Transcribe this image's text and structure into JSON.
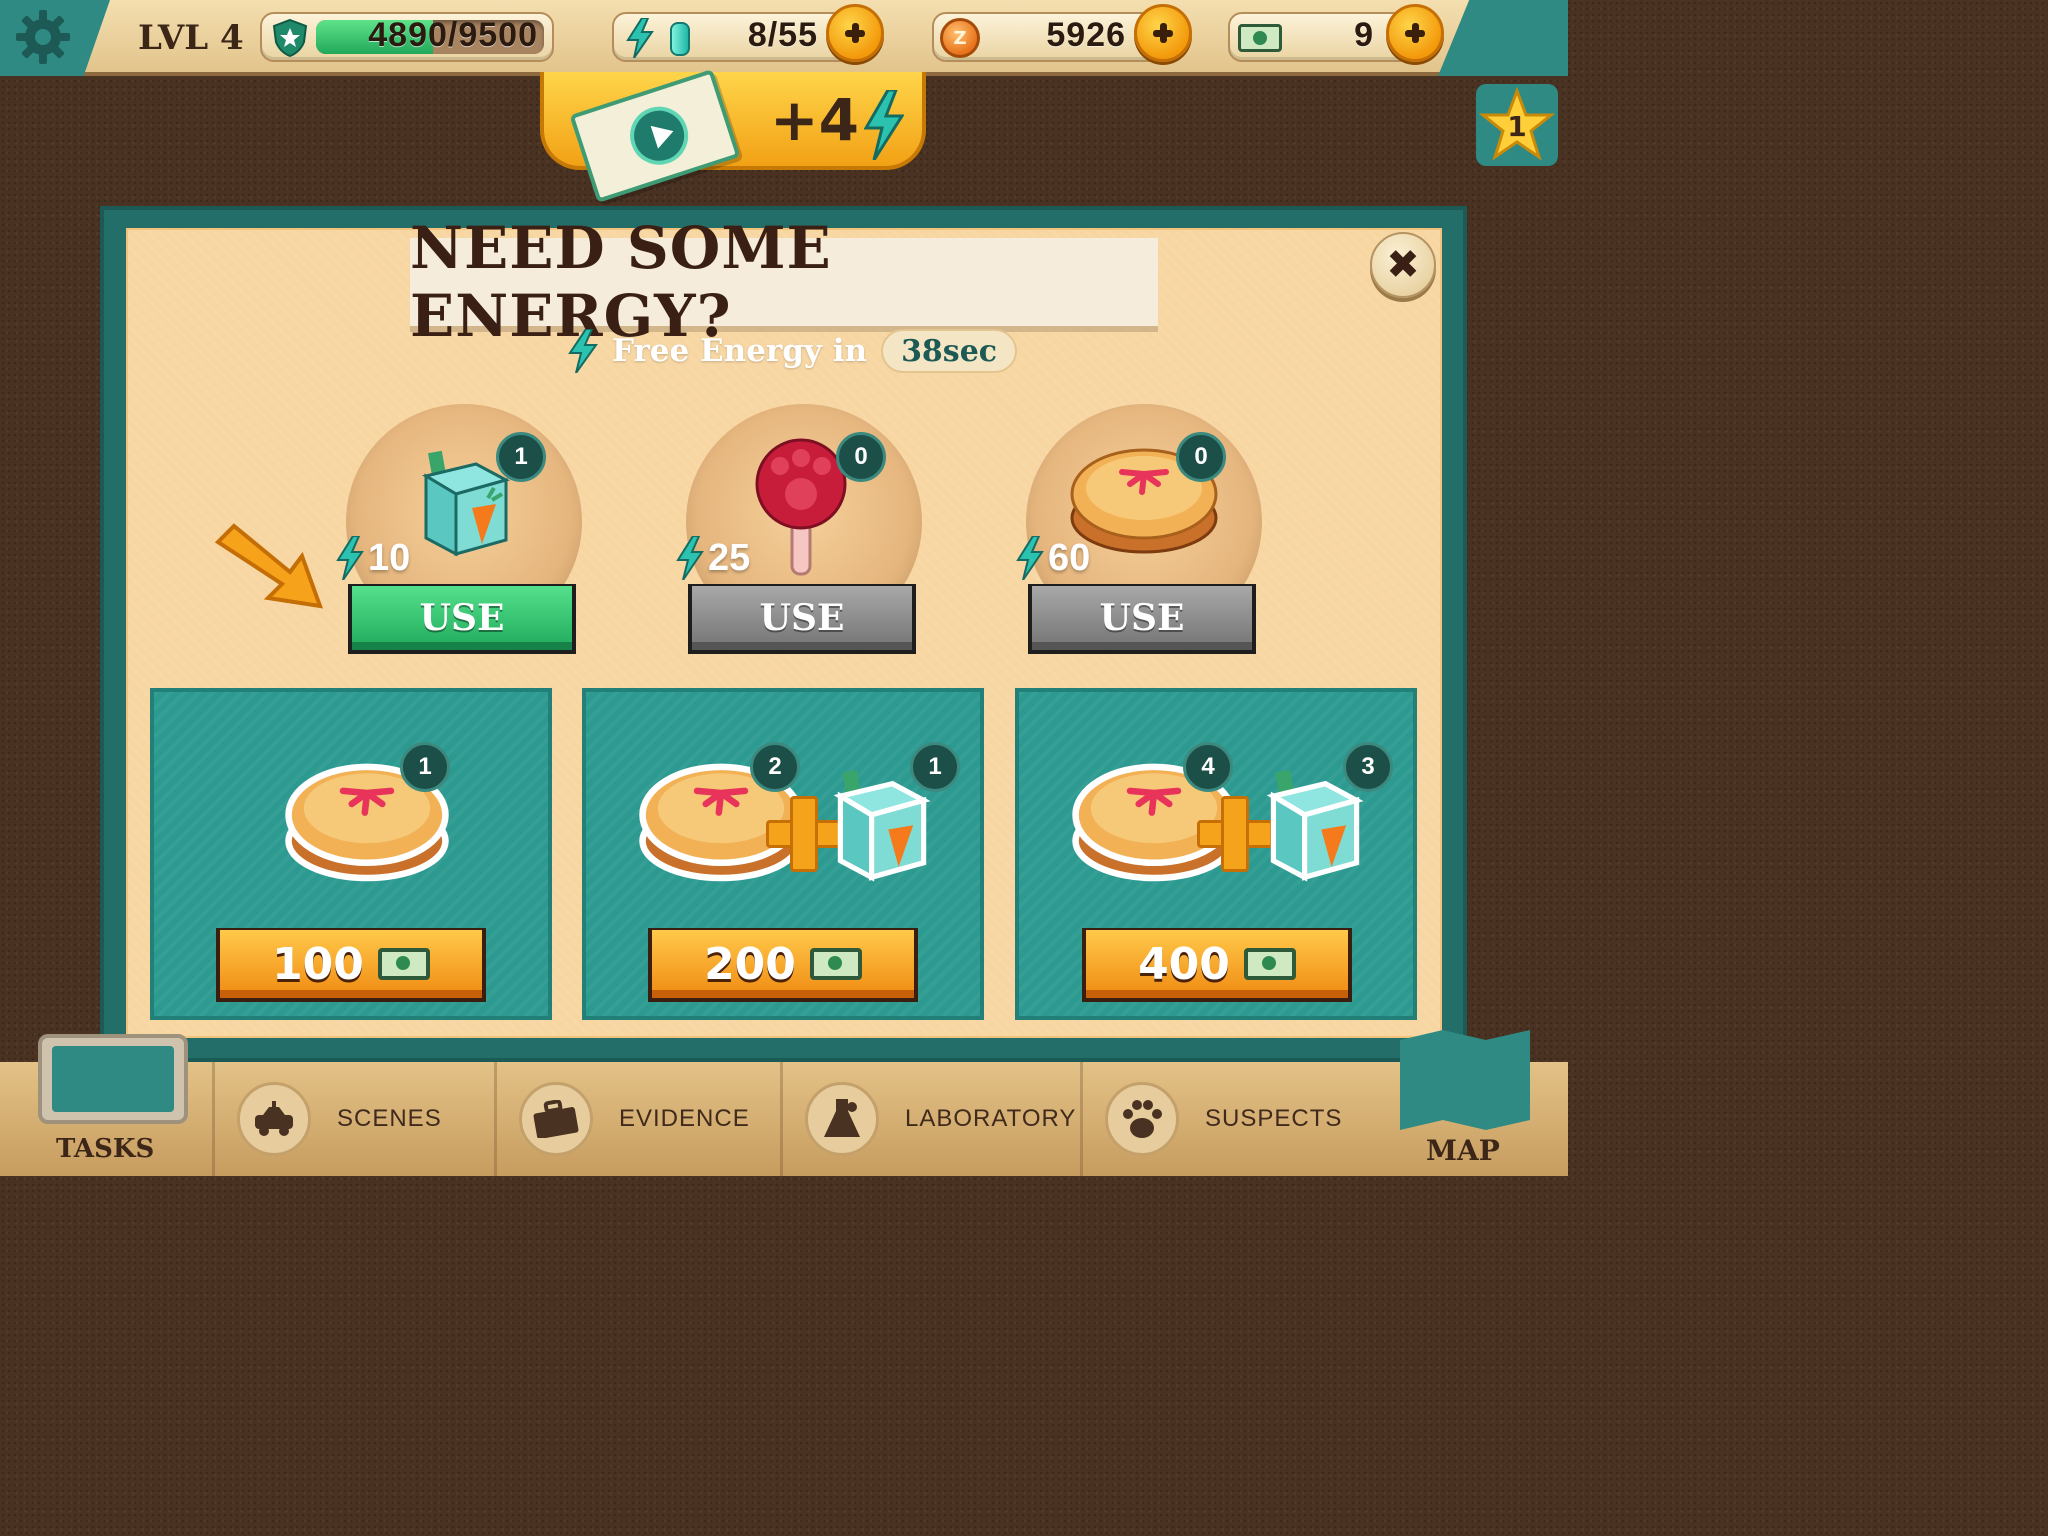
{
  "hud": {
    "level": "LVL 4",
    "xp": {
      "text": "4890/9500",
      "current": 4890,
      "max": 9500
    },
    "energy": {
      "text": "8/55",
      "current": 8,
      "max": 55
    },
    "coins": {
      "text": "5926",
      "symbol": "Z"
    },
    "cash": {
      "text": "9"
    }
  },
  "video_reward": {
    "text": "+4"
  },
  "star_badge": {
    "count": "1"
  },
  "modal": {
    "title": "NEED SOME ENERGY?",
    "free_energy_label": "Free Energy in",
    "timer": "38sec",
    "items": [
      {
        "name": "juice-box",
        "count": "1",
        "energy": "10",
        "button": "USE",
        "enabled": true
      },
      {
        "name": "paw-lollipop",
        "count": "0",
        "energy": "25",
        "button": "USE",
        "enabled": false
      },
      {
        "name": "pie",
        "count": "0",
        "energy": "60",
        "button": "USE",
        "enabled": false
      }
    ],
    "packs": [
      {
        "pie_count": "1",
        "price": "100"
      },
      {
        "pie_count": "2",
        "juice_count": "1",
        "price": "200"
      },
      {
        "pie_count": "4",
        "juice_count": "3",
        "price": "400"
      }
    ]
  },
  "nav": {
    "tasks": "TASKS",
    "scenes": "SCENES",
    "evidence": "EVIDENCE",
    "laboratory": "LABORATORY",
    "suspects": "SUSPECTS",
    "map": "MAP"
  },
  "colors": {
    "teal": "#2e8a82",
    "use_active": "#1faa5c",
    "use_disabled": "#737373",
    "price_orange": "#f08a12"
  }
}
